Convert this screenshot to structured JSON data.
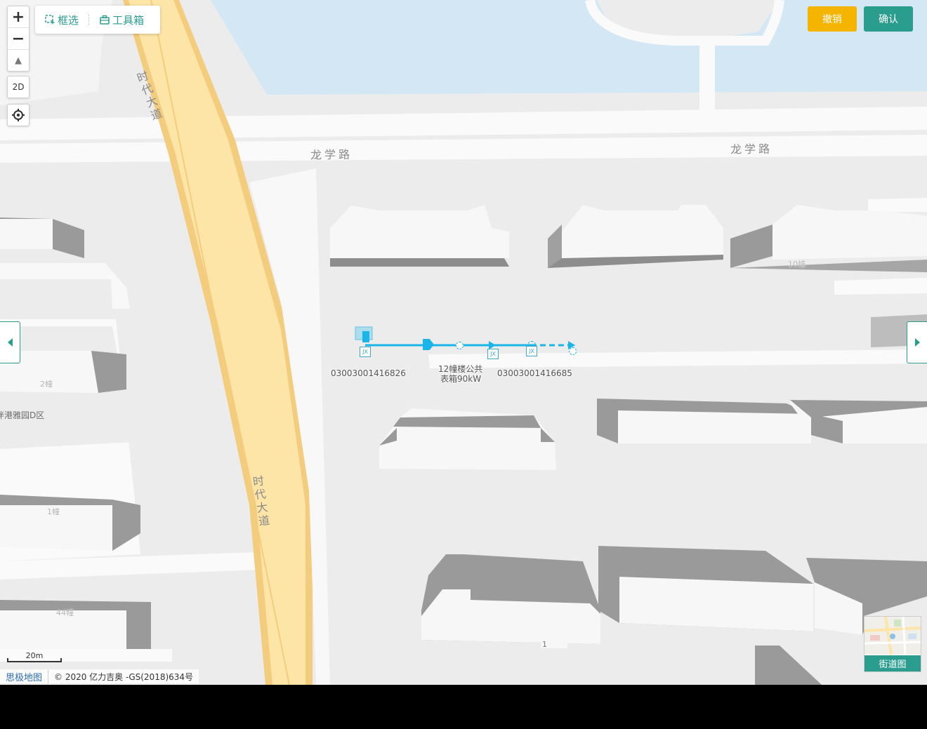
{
  "map": {
    "roads": {
      "horizontal_north_left": "龙学路",
      "horizontal_north_right": "龙学路",
      "vertical_upper": "时代大道",
      "vertical_lower": "时代大道"
    },
    "building_labels": [
      "10幢",
      "2幢",
      "1幢",
      "44幢",
      "1"
    ],
    "area_label": "泮港雅园D区",
    "meters": {
      "left_id": "03003001416826",
      "right_id": "03003001416685",
      "center_name_line1": "12幢楼公共",
      "center_name_line2": "表箱90kW",
      "icon_text": "JX"
    },
    "colors": {
      "accent": "#2a9d8f",
      "warn": "#f5b400",
      "line": "#1bb5e8",
      "water": "#d4e7f5",
      "road_major": "#fde5a8",
      "road_major_edge": "#f3cd7d"
    }
  },
  "controls": {
    "zoom_in": "+",
    "zoom_out": "−",
    "compass": "▲",
    "view_mode": "2D",
    "locate_icon": "locate-icon"
  },
  "toolbar": {
    "box_select": "框选",
    "toolbox": "工具箱"
  },
  "actions": {
    "undo": "撤销",
    "confirm": "确认"
  },
  "scale": {
    "label": "20m"
  },
  "attribution": {
    "brand": "思极地图",
    "copyright": "© 2020 亿力吉奥 -GS(2018)634号"
  },
  "street_view": {
    "label": "街道图"
  }
}
